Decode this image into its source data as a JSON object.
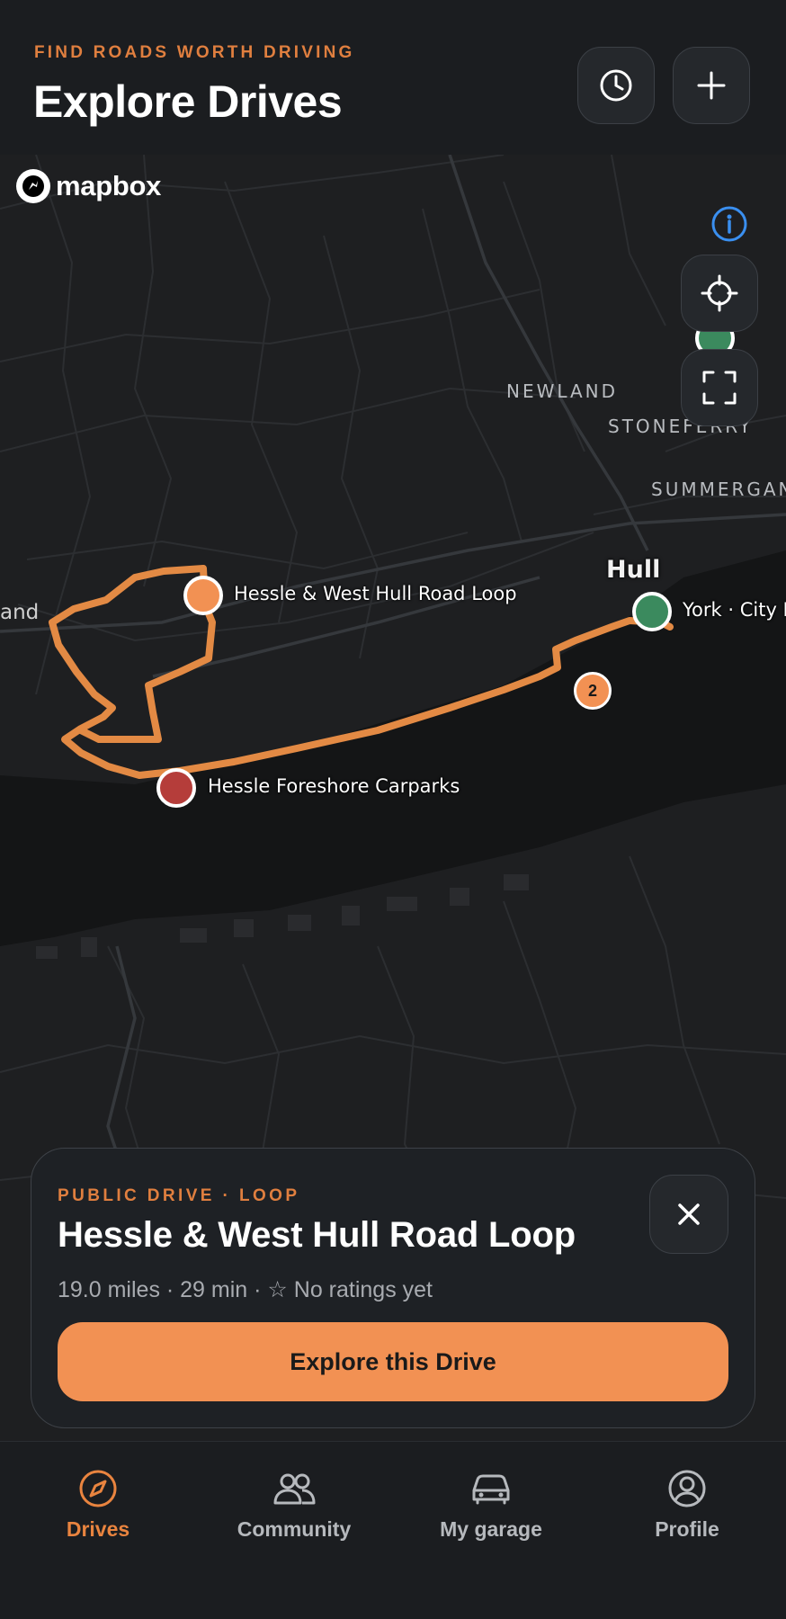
{
  "header": {
    "eyebrow": "FIND ROADS WORTH DRIVING",
    "title": "Explore Drives",
    "buttons": [
      {
        "name": "history",
        "icon": "clock-icon"
      },
      {
        "name": "add",
        "icon": "plus-icon"
      }
    ]
  },
  "map": {
    "attribution": "mapbox",
    "place_labels": [
      "NEWLAND",
      "STONEFERRY",
      "SUMMERGAN"
    ],
    "city_label": "Hull",
    "edge_label": "and",
    "cluster_count": "2",
    "pins": [
      {
        "label": "Hessle & West Hull Road Loop",
        "color": "#f29153"
      },
      {
        "label": "York · City E",
        "color": "#3b8a5e"
      },
      {
        "label": "Hessle Foreshore Carparks",
        "color": "#b53d3a"
      }
    ],
    "route_color": "#e38a44",
    "controls": [
      {
        "name": "info",
        "icon": "info-icon"
      },
      {
        "name": "recenter",
        "icon": "crosshair-icon"
      },
      {
        "name": "fullscreen",
        "icon": "expand-icon"
      }
    ]
  },
  "drive_card": {
    "eyebrow": "PUBLIC DRIVE · LOOP",
    "title": "Hessle & West Hull Road Loop",
    "meta": "19.0 miles · 29 min · ☆ No ratings yet",
    "cta": "Explore this Drive"
  },
  "tabs": [
    {
      "label": "Drives",
      "icon": "compass-icon",
      "active": true
    },
    {
      "label": "Community",
      "icon": "people-icon",
      "active": false
    },
    {
      "label": "My garage",
      "icon": "car-icon",
      "active": false
    },
    {
      "label": "Profile",
      "icon": "user-circle-icon",
      "active": false
    }
  ],
  "colors": {
    "accent": "#e9843f",
    "background": "#16181b"
  }
}
